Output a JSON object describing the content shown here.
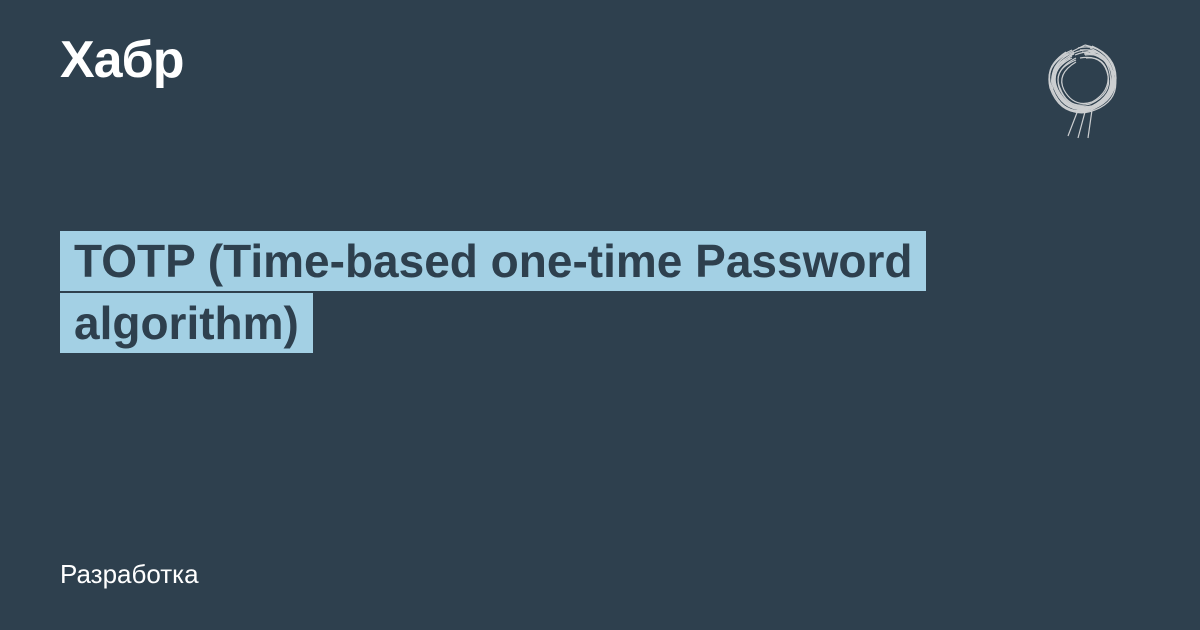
{
  "header": {
    "logo": "Хабр"
  },
  "main": {
    "title": "TOTP (Time-based one-time Password algorithm)"
  },
  "footer": {
    "category": "Разработка"
  }
}
